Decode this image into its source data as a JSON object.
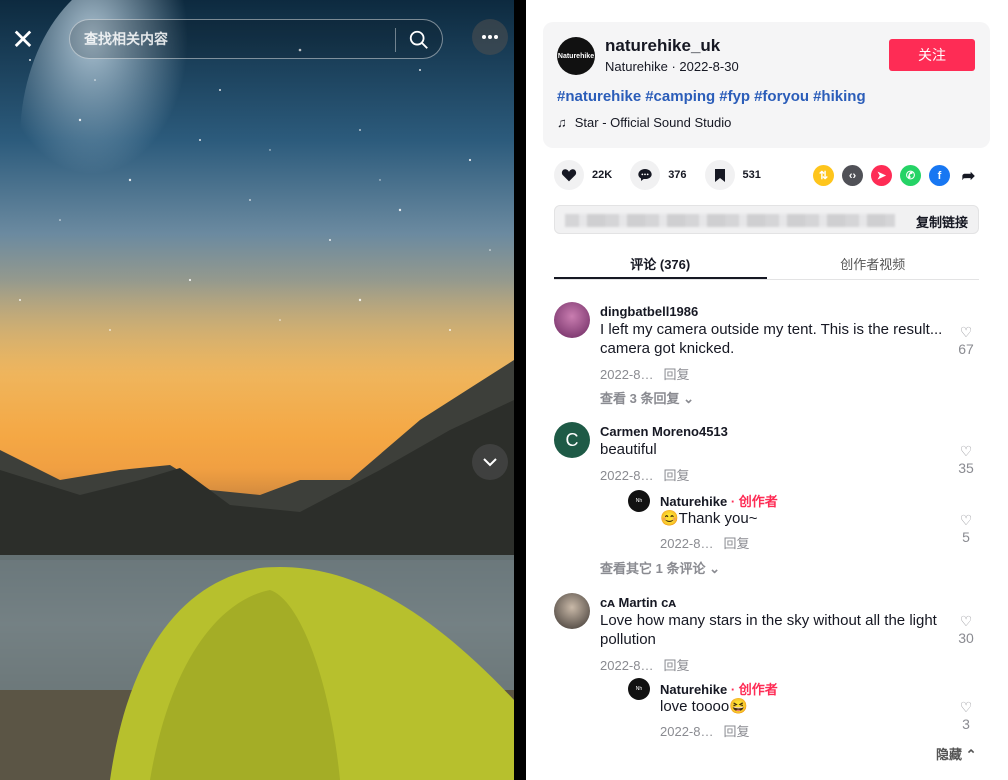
{
  "search": {
    "placeholder": "查找相关内容"
  },
  "author": {
    "handle": "naturehike_uk",
    "display": "Naturehike · 2022-8-30",
    "avatar_text": "Naturehike",
    "follow_label": "关注"
  },
  "hashtags": [
    "#naturehike",
    "#camping",
    "#fyp",
    "#foryou",
    "#hiking"
  ],
  "music": "Star - Official Sound Studio",
  "stats": {
    "likes": "22K",
    "comments": "376",
    "saves": "531"
  },
  "copy_link": "复制链接",
  "tabs": {
    "comments": "评论 (376)",
    "creator": "创作者视频"
  },
  "comments": [
    {
      "user": "dingbatbell1986",
      "text": "I left my camera outside my tent. This is the result... camera got knicked.",
      "date": "2022-8…",
      "reply_label": "回复",
      "likes": "67",
      "more": "查看 3 条回复"
    },
    {
      "user": "Carmen Moreno4513",
      "avatar_letter": "C",
      "text": "beautiful",
      "date": "2022-8…",
      "reply_label": "回复",
      "likes": "35",
      "reply": {
        "user": "Naturehike",
        "tag": "· 创作者",
        "text": "😊Thank you~",
        "date": "2022-8…",
        "reply_label": "回复",
        "likes": "5"
      },
      "more": "查看其它 1 条评论"
    },
    {
      "user": "ᴄᴀ Martin ᴄᴀ",
      "text": "Love how many stars in the sky without all the light pollution",
      "date": "2022-8…",
      "reply_label": "回复",
      "likes": "30",
      "reply": {
        "user": "Naturehike",
        "tag": "· 创作者",
        "text": "love toooo😆",
        "date": "2022-8…",
        "reply_label": "回复",
        "likes": "3"
      }
    }
  ],
  "hide_label": "隐藏",
  "colors": {
    "accent": "#fe2c55",
    "hashtag": "#2b5db9"
  }
}
